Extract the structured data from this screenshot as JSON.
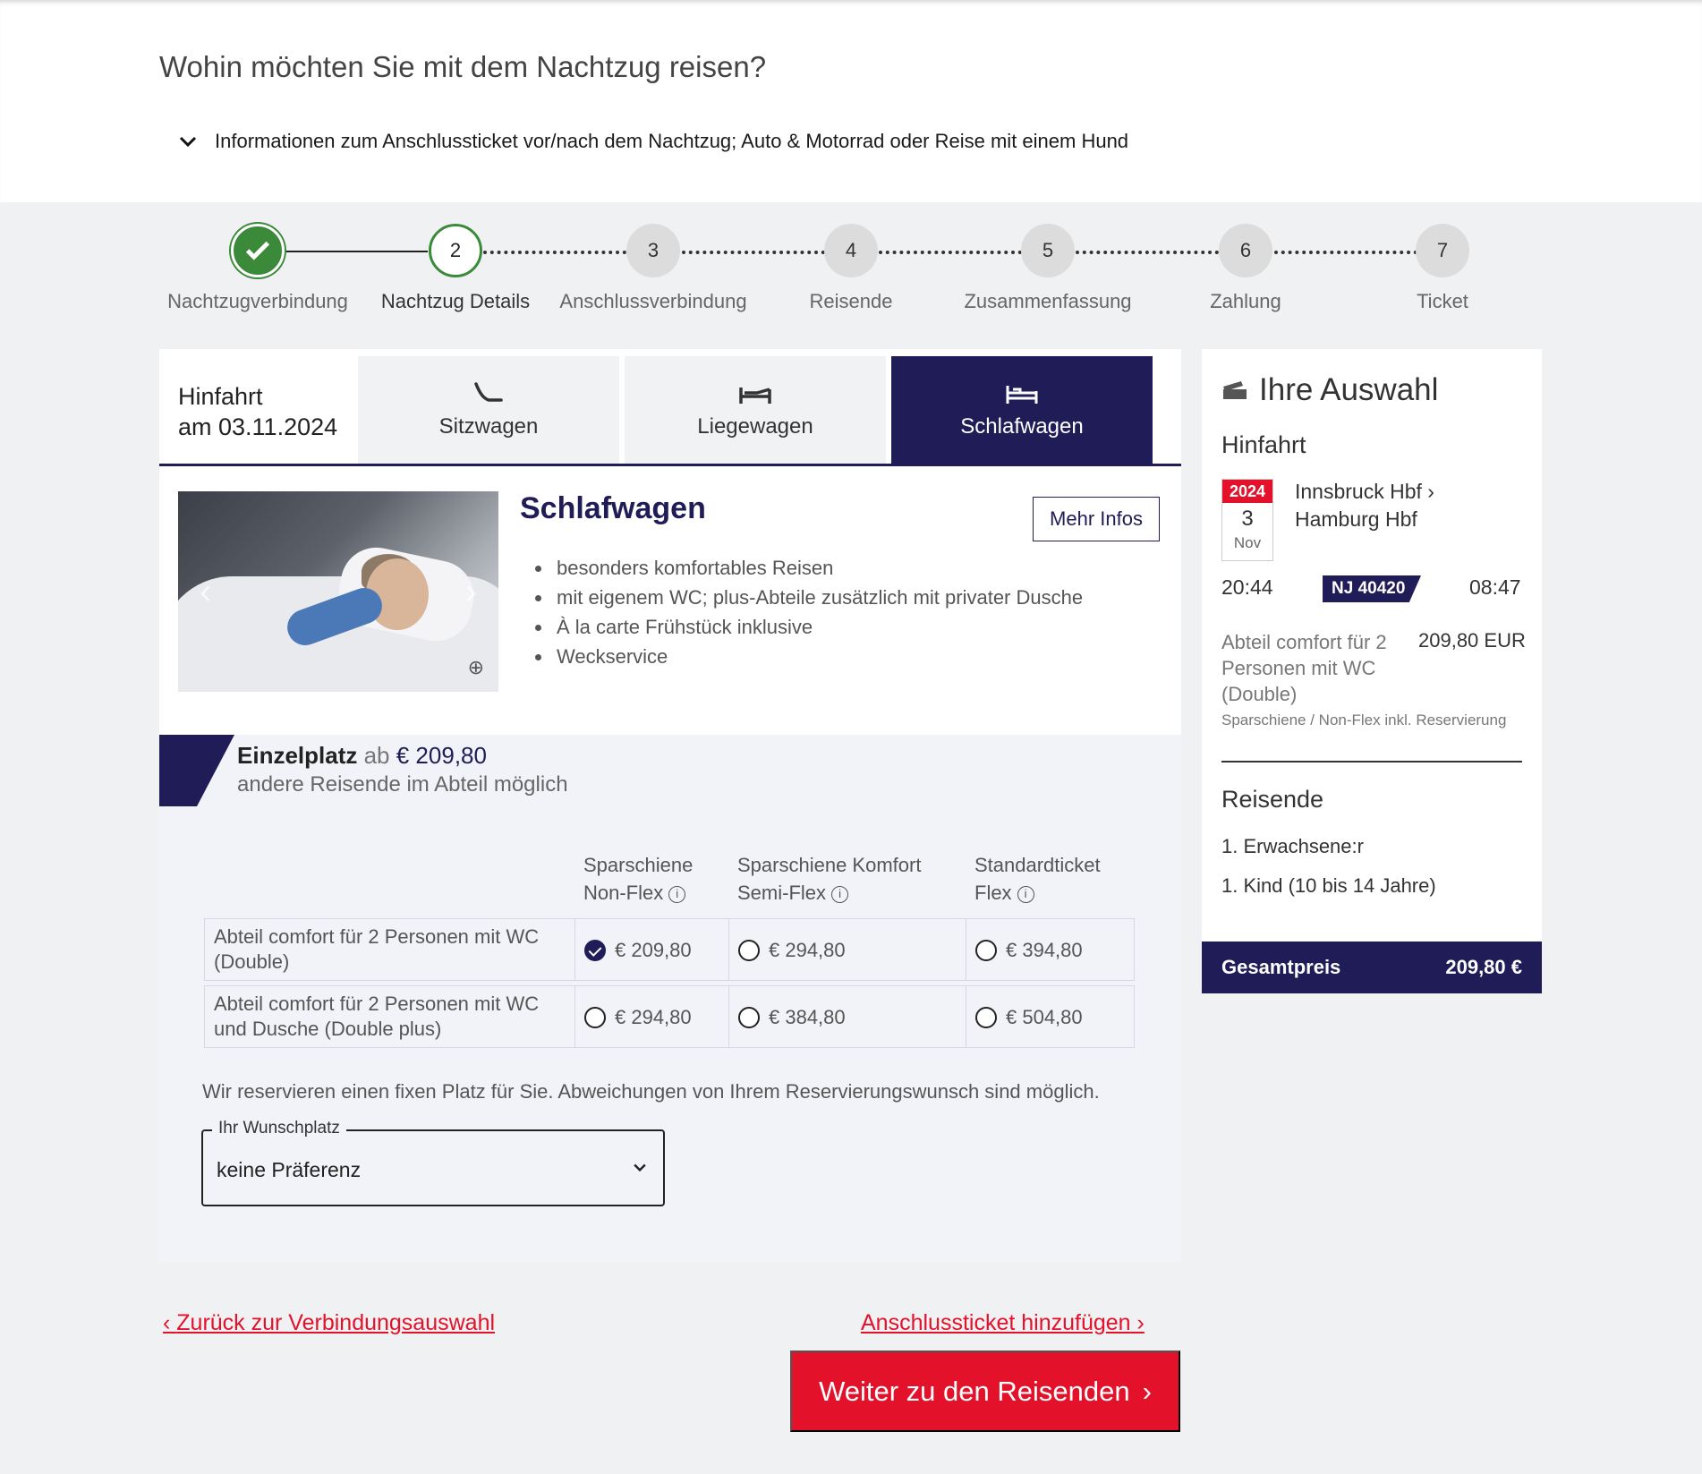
{
  "page": {
    "title": "Wohin möchten Sie mit dem Nachtzug reisen?",
    "info_toggle": "Informationen zum Anschlussticket vor/nach dem Nachtzug; Auto & Motorrad oder Reise mit einem Hund"
  },
  "stepper": {
    "steps": [
      {
        "number": "1",
        "label": "Nachtzugverbindung",
        "state": "done"
      },
      {
        "number": "2",
        "label": "Nachtzug Details",
        "state": "active"
      },
      {
        "number": "3",
        "label": "Anschlussverbindung",
        "state": "todo"
      },
      {
        "number": "4",
        "label": "Reisende",
        "state": "todo"
      },
      {
        "number": "5",
        "label": "Zusammenfassung",
        "state": "todo"
      },
      {
        "number": "6",
        "label": "Zahlung",
        "state": "todo"
      },
      {
        "number": "7",
        "label": "Ticket",
        "state": "todo"
      }
    ]
  },
  "tabs": {
    "date_line1": "Hinfahrt",
    "date_line2": "am 03.11.2024",
    "items": [
      {
        "label": "Sitzwagen",
        "icon": "seat-icon"
      },
      {
        "label": "Liegewagen",
        "icon": "couchette-icon"
      },
      {
        "label": "Schlafwagen",
        "icon": "bed-icon",
        "active": true
      }
    ]
  },
  "detail": {
    "title": "Schlafwagen",
    "more_button": "Mehr Infos",
    "bullets": [
      "besonders komfortables Reisen",
      "mit eigenem WC; plus-Abteile zusätzlich mit privater Dusche",
      "À la carte Frühstück inklusive",
      "Weckservice"
    ]
  },
  "offer": {
    "title": "Einzelplatz",
    "ab": "ab",
    "price": "€ 209,80",
    "subtitle": "andere Reisende im Abteil möglich",
    "columns": [
      {
        "line1": "Sparschiene",
        "line2": "Non-Flex"
      },
      {
        "line1": "Sparschiene Komfort",
        "line2": "Semi-Flex"
      },
      {
        "line1": "Standardticket",
        "line2": "Flex"
      }
    ],
    "rows": [
      {
        "name": "Abteil comfort für 2 Personen mit WC (Double)",
        "prices": [
          "€ 209,80",
          "€ 294,80",
          "€ 394,80"
        ],
        "selected": 0
      },
      {
        "name": "Abteil comfort für 2 Personen mit WC und Dusche (Double plus)",
        "prices": [
          "€ 294,80",
          "€ 384,80",
          "€ 504,80"
        ],
        "selected": -1
      }
    ],
    "note": "Wir reservieren einen fixen Platz für Sie. Abweichungen von Ihrem Reservierungswunsch sind möglich.",
    "select_legend": "Ihr Wunschplatz",
    "select_value": "keine Präferenz"
  },
  "sidebar": {
    "title": "Ihre Auswahl",
    "direction": "Hinfahrt",
    "date": {
      "year": "2024",
      "day": "3",
      "month": "Nov"
    },
    "from": "Innsbruck Hbf",
    "to": "Hamburg Hbf",
    "departure": "20:44",
    "train": "NJ 40420",
    "arrival": "08:47",
    "category": "Abteil comfort für 2 Personen mit WC (Double)",
    "price": "209,80 EUR",
    "fare": "Sparschiene / Non-Flex inkl. Reservierung",
    "travellers_title": "Reisende",
    "travellers": [
      "1. Erwachsene:r",
      "1. Kind (10 bis 14 Jahre)"
    ],
    "total_label": "Gesamtpreis",
    "total_value": "209,80 €"
  },
  "footer": {
    "back": "Zurück zur Verbindungsauswahl",
    "add": "Anschlussticket hinzufügen",
    "cta": "Weiter zu den Reisenden"
  },
  "colors": {
    "brand_navy": "#1f1c57",
    "brand_red": "#e3112a",
    "success_green": "#3a8a3a"
  }
}
